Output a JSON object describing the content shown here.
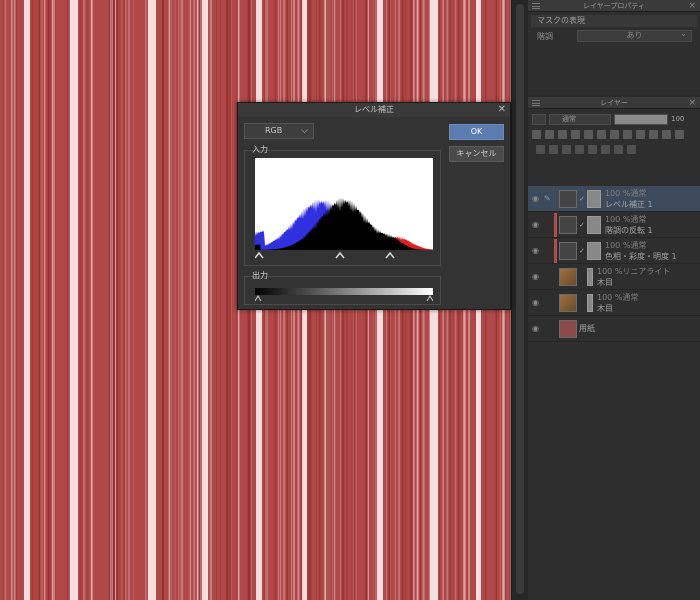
{
  "canvas": {
    "base_color": "#f4dede",
    "stripe_color": "#b04848",
    "dark_color": "#8a2020"
  },
  "dialog": {
    "title": "レベル補正",
    "channel": "RGB",
    "ok_label": "OK",
    "cancel_label": "キャンセル",
    "input_label": "入力",
    "output_label": "出力",
    "histogram_colors": {
      "blue": "#3030e0",
      "black": "#000000",
      "red": "#e02020"
    }
  },
  "property_panel": {
    "title": "レイヤープロパティ",
    "section": "マスクの表現",
    "row_label": "階調",
    "row_value": "あり"
  },
  "layer_panel": {
    "title": "レイヤー",
    "blend_mode": "通常",
    "opacity": "100",
    "layers": [
      {
        "mode": "100 %通常",
        "name": "レベル補正 1",
        "selected": true
      },
      {
        "mode": "100 %通常",
        "name": "階調の反転 1"
      },
      {
        "mode": "100 %通常",
        "name": "色相・彩度・明度 1"
      },
      {
        "mode": "100 %リニアライト",
        "name": "木目"
      },
      {
        "mode": "100 %通常",
        "name": "木目"
      },
      {
        "mode": "",
        "name": "用紙"
      }
    ]
  }
}
